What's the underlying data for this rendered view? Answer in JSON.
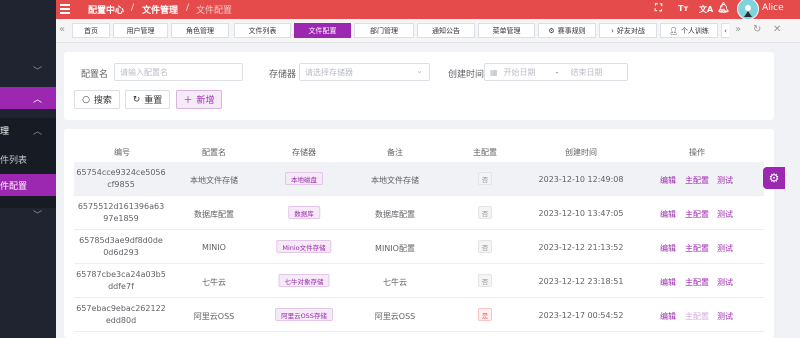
{
  "topbar": {
    "breadcrumb": [
      "配置中心",
      "文件管理",
      "文件配置"
    ],
    "user_name": "Alice",
    "icons": [
      "fullscreen-icon",
      "font-size-icon",
      "translate-icon",
      "bell-icon"
    ],
    "accent_color": "#e64b4b"
  },
  "sidebar": {
    "section_label": "理",
    "items": [
      "件列表",
      "件配置"
    ],
    "primary_color": "#9c27b0"
  },
  "tabs": [
    "首页",
    "用户管理",
    "角色管理",
    "文件列表",
    "文件配置",
    "部门管理",
    "通知公告",
    "菜单管理",
    "赛事规则",
    "好友对战",
    "个人训练"
  ],
  "active_tab": "文件配置",
  "search": {
    "name_label": "配置名",
    "name_placeholder": "请输入配置名",
    "storage_label": "存储器",
    "storage_placeholder": "请选择存储器",
    "time_label": "创建时间",
    "start_placeholder": "开始日期",
    "range_sep": "-",
    "end_placeholder": "结束日期",
    "search_button": "搜索",
    "reset_button": "重置",
    "add_button": "新增"
  },
  "table": {
    "columns": [
      "编号",
      "配置名",
      "存储器",
      "备注",
      "主配置",
      "创建时间",
      "操作"
    ],
    "rows": [
      {
        "id_line1": "65754cce9324ce5056",
        "id_line2": "cf9855",
        "name": "本地文件存储",
        "storage": "本地磁盘",
        "remark": "本地文件存储",
        "master": "否",
        "created": "2023-12-10 12:49:08"
      },
      {
        "id_line1": "6575512d161396a63",
        "id_line2": "97e1859",
        "name": "数据库配置",
        "storage": "数据库",
        "remark": "数据库配置",
        "master": "否",
        "created": "2023-12-10 13:47:05"
      },
      {
        "id_line1": "65785d3ae9df8d0de",
        "id_line2": "0d6d293",
        "name": "MINIO",
        "storage": "Minio文件存储",
        "remark": "MINIO配置",
        "master": "否",
        "created": "2023-12-12 21:13:52"
      },
      {
        "id_line1": "65787cbe3ca24a03b5",
        "id_line2": "ddfe7f",
        "name": "七牛云",
        "storage": "七牛对象存储",
        "remark": "七牛云",
        "master": "否",
        "created": "2023-12-12 23:18:51"
      },
      {
        "id_line1": "657ebac9ebac262122",
        "id_line2": "edd80d",
        "name": "阿里云OSS",
        "storage": "阿里云OSS存储",
        "remark": "阿里云OSS",
        "master": "是",
        "created": "2023-12-17 00:54:52"
      }
    ],
    "actions": {
      "edit": "编辑",
      "set_master": "主配置",
      "test": "测试"
    }
  }
}
